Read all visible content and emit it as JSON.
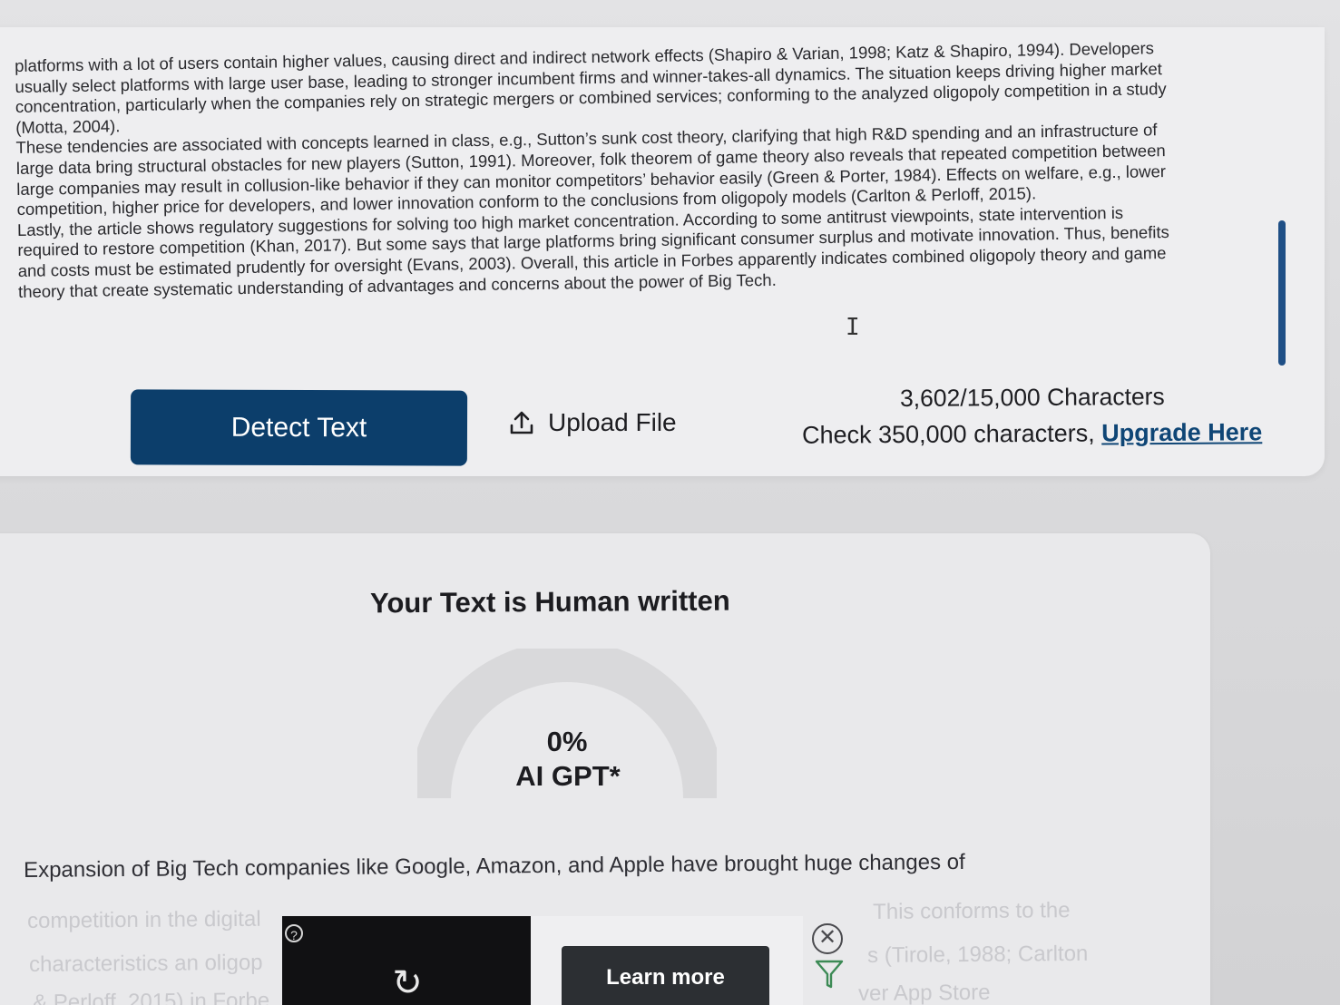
{
  "essay": {
    "lines": [
      "platforms with a lot of users contain higher values, causing direct and indirect network effects (Shapiro & Varian, 1998; Katz & Shapiro, 1994). Developers",
      "usually select platforms with large user base, leading to stronger incumbent firms and winner-takes-all dynamics. The situation keeps driving higher market",
      "concentration, particularly when the companies rely on strategic mergers or combined services; conforming to the analyzed oligopoly competition in a study",
      "(Motta, 2004).",
      "These tendencies are associated with concepts learned in class, e.g., Sutton’s sunk cost theory, clarifying that high R&D spending and an infrastructure of",
      "large data bring structural obstacles for new players (Sutton, 1991). Moreover, folk theorem of game theory also reveals that repeated competition between",
      "large companies may result in collusion-like behavior if they can monitor competitors’ behavior easily (Green & Porter, 1984). Effects on welfare, e.g., lower",
      "competition, higher price for developers, and lower innovation conform to the conclusions from oligopoly models (Carlton & Perloff, 2015).",
      "Lastly, the article shows regulatory suggestions for solving too high market concentration. According to some antitrust viewpoints, state intervention is",
      "required to restore competition (Khan, 2017). But some says that large platforms bring significant consumer surplus and motivate innovation. Thus, benefits",
      "and costs must be estimated prudently for oversight (Evans, 2003). Overall, this article in Forbes apparently indicates combined oligopoly theory and game",
      "theory that create systematic understanding of advantages and concerns about the power of Big Tech."
    ]
  },
  "toolbar": {
    "detect_label": "Detect Text",
    "upload_label": "Upload File",
    "char_count": "3,602/15,000 Characters",
    "upgrade_prefix": "Check 350,000 characters, ",
    "upgrade_link": "Upgrade Here"
  },
  "result": {
    "title": "Your Text is Human written",
    "percent": "0%",
    "percent_value": 0,
    "label": "AI GPT*",
    "summary": "Expansion of Big Tech companies like Google, Amazon, and Apple have brought huge changes of",
    "faded_1_left": "competition in the digital",
    "faded_1_right": "This conforms to the",
    "faded_2_left": "characteristics an oligop",
    "faded_2_right": "s (Tirole, 1988; Carlton",
    "faded_3_left": "& Perloff, 2015) in Forbe",
    "faded_3_right": "ver App Store"
  },
  "ad": {
    "help": "?",
    "learn_more": "Learn more"
  },
  "colors": {
    "primary": "#0c3e6b",
    "link": "#0f4676",
    "scrollbar": "#1f4f86",
    "gauge_track": "#d9d9db"
  }
}
